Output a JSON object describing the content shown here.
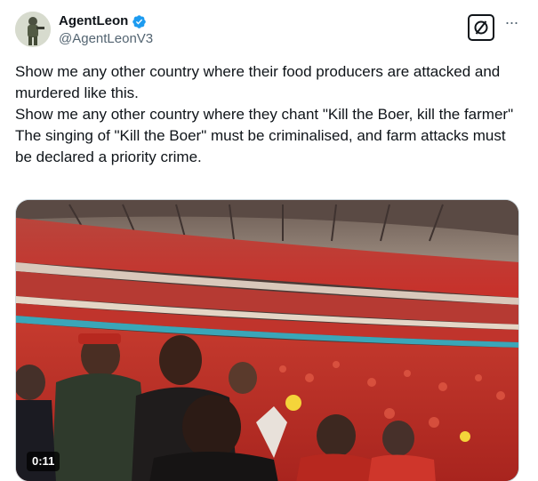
{
  "author": {
    "display_name": "AgentLeon",
    "handle": "@AgentLeonV3",
    "verified": true
  },
  "actions": {
    "grok_icon": "grok-icon",
    "more_icon": "more-icon",
    "more_label": "···"
  },
  "tweet": {
    "lines": [
      "Show me any other country where their food producers are attacked and murdered like this.",
      "Show me any other country where they chant \"Kill the Boer, kill the farmer\"",
      "The singing of \"Kill the Boer\" must be criminalised, and farm attacks must be declared a priority crime."
    ]
  },
  "media": {
    "type": "video",
    "duration": "0:11"
  },
  "colors": {
    "text": "#0f1419",
    "secondary": "#536471",
    "verified": "#1d9bf0",
    "crowd_red": "#c8302a"
  }
}
